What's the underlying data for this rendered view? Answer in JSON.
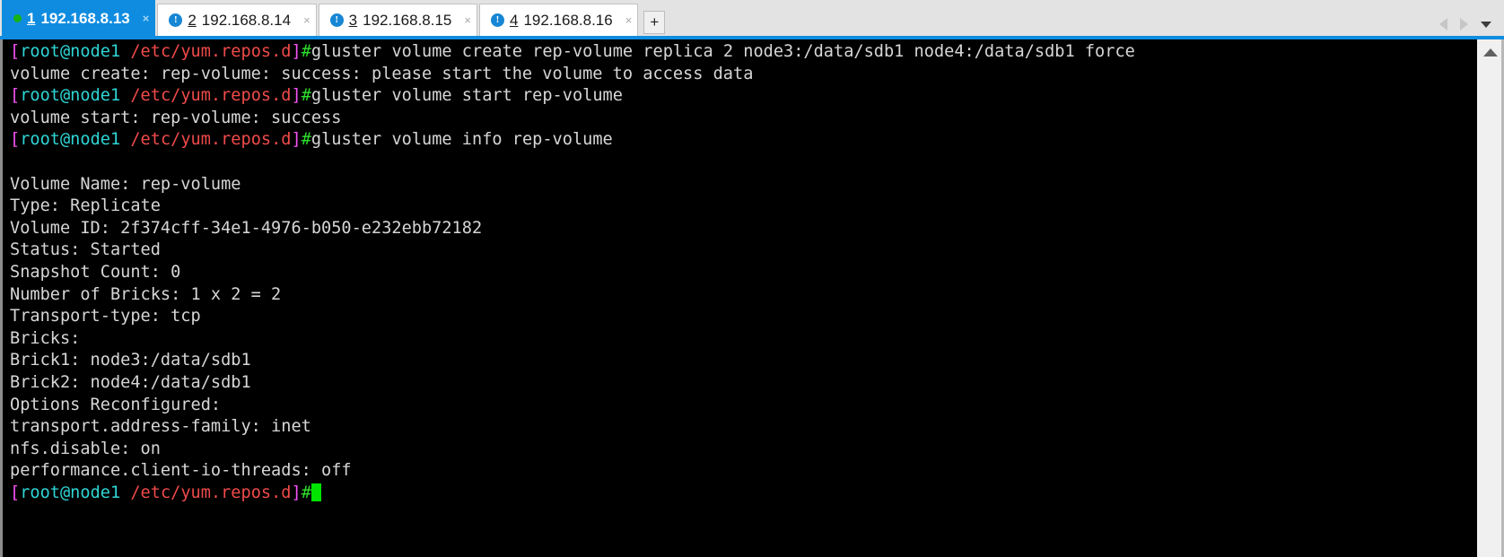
{
  "window": {
    "accent_color": "#0f8ce0",
    "tabbar_bg": "#e3e3e3"
  },
  "tabs": [
    {
      "number": "1",
      "label": "192.168.8.13",
      "active": true,
      "status_icon": "green-dot-icon",
      "close_label": "×"
    },
    {
      "number": "2",
      "label": "192.168.8.14",
      "active": false,
      "status_icon": "info-exclamation-icon",
      "close_label": "×"
    },
    {
      "number": "3",
      "label": "192.168.8.15",
      "active": false,
      "status_icon": "info-exclamation-icon",
      "close_label": "×"
    },
    {
      "number": "4",
      "label": "192.168.8.16",
      "active": false,
      "status_icon": "info-exclamation-icon",
      "close_label": "×"
    }
  ],
  "tabbar_controls": {
    "new_tab_label": "+",
    "scroll_left_icon": "triangle-left-icon",
    "scroll_right_icon": "triangle-right-icon",
    "tab_list_icon": "chevron-down-icon"
  },
  "scrollbar": {
    "up_arrow_icon": "chevron-up-icon"
  },
  "terminal": {
    "prompt": {
      "open_bracket": "[",
      "user_host": "root@node1",
      "path": "/etc/yum.repos.d",
      "close_bracket": "]",
      "hash": "#"
    },
    "colors": {
      "bracket": "#f452f4",
      "user": "#2fd6d6",
      "path": "#f04a4a",
      "hash": "#2ee02e",
      "output": "#d6d6d6",
      "cursor": "#00e400",
      "background": "#000000"
    },
    "lines": [
      {
        "type": "prompt",
        "command": "gluster volume create rep-volume replica 2 node3:/data/sdb1 node4:/data/sdb1 force"
      },
      {
        "type": "output",
        "text": "volume create: rep-volume: success: please start the volume to access data"
      },
      {
        "type": "prompt",
        "command": "gluster volume start rep-volume"
      },
      {
        "type": "output",
        "text": "volume start: rep-volume: success"
      },
      {
        "type": "prompt",
        "command": "gluster volume info rep-volume"
      },
      {
        "type": "output",
        "text": ""
      },
      {
        "type": "output",
        "text": "Volume Name: rep-volume"
      },
      {
        "type": "output",
        "text": "Type: Replicate"
      },
      {
        "type": "output",
        "text": "Volume ID: 2f374cff-34e1-4976-b050-e232ebb72182"
      },
      {
        "type": "output",
        "text": "Status: Started"
      },
      {
        "type": "output",
        "text": "Snapshot Count: 0"
      },
      {
        "type": "output",
        "text": "Number of Bricks: 1 x 2 = 2"
      },
      {
        "type": "output",
        "text": "Transport-type: tcp"
      },
      {
        "type": "output",
        "text": "Bricks:"
      },
      {
        "type": "output",
        "text": "Brick1: node3:/data/sdb1"
      },
      {
        "type": "output",
        "text": "Brick2: node4:/data/sdb1"
      },
      {
        "type": "output",
        "text": "Options Reconfigured:"
      },
      {
        "type": "output",
        "text": "transport.address-family: inet"
      },
      {
        "type": "output",
        "text": "nfs.disable: on"
      },
      {
        "type": "output",
        "text": "performance.client-io-threads: off"
      },
      {
        "type": "prompt",
        "command": "",
        "cursor": true
      }
    ]
  }
}
